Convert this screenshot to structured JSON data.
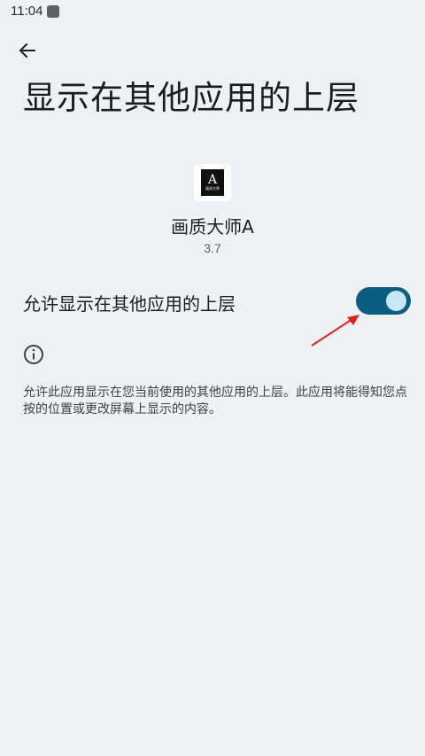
{
  "status_bar": {
    "time": "11:04"
  },
  "header": {
    "back_icon": "arrow-left-icon",
    "title": "显示在其他应用的上层"
  },
  "app": {
    "icon_letter": "A",
    "icon_caption": "画质大师",
    "name": "画质大师A",
    "version": "3.7"
  },
  "setting": {
    "label": "允许显示在其他应用的上层",
    "enabled": true,
    "toggle_color": "#0b5d80",
    "knob_color": "#c7e6f7"
  },
  "annotation": {
    "arrow_color": "#e02020"
  },
  "info": {
    "icon": "info-icon",
    "description": "允许此应用显示在您当前使用的其他应用的上层。此应用将能得知您点按的位置或更改屏幕上显示的内容。"
  }
}
